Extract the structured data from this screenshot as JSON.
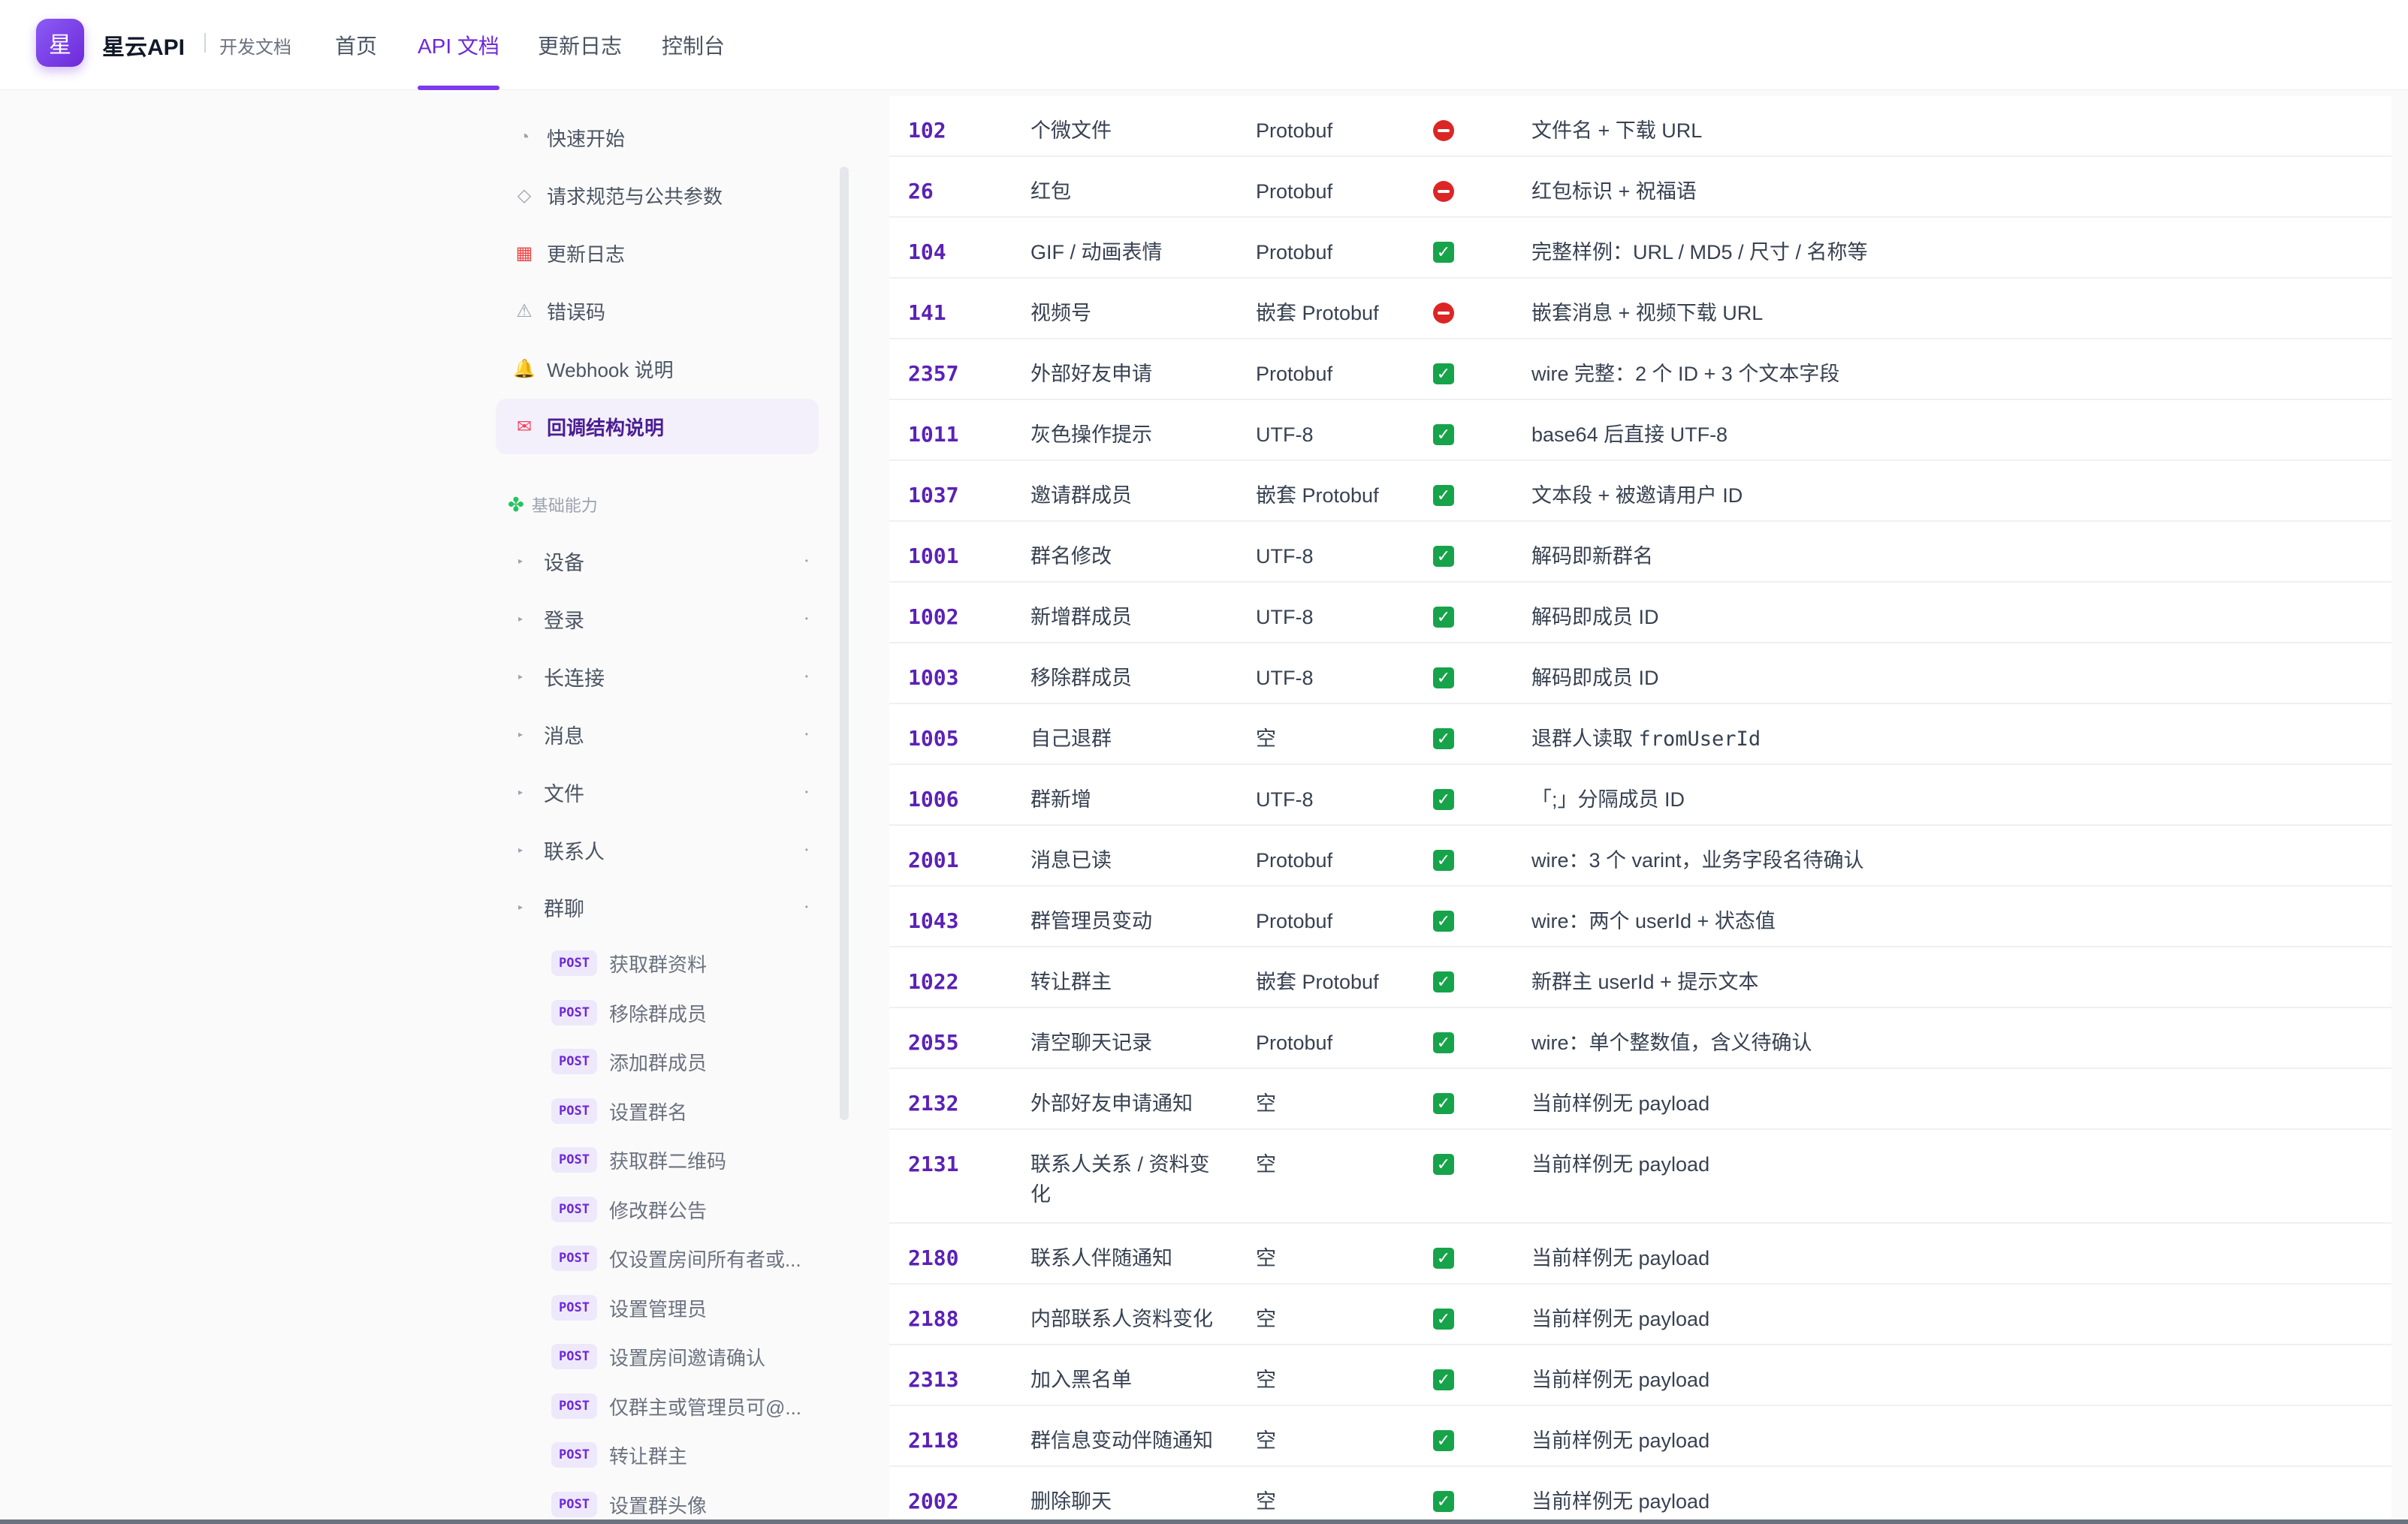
{
  "header": {
    "logo_char": "星",
    "brand": "星云API",
    "subtitle": "开发文档",
    "nav": [
      "首页",
      "API 文档",
      "更新日志",
      "控制台"
    ],
    "active_nav": "API 文档"
  },
  "sidebar": {
    "items": [
      {
        "icon": "◔",
        "icon_name": "clock-icon",
        "label": "快速开始"
      },
      {
        "icon": "◇",
        "icon_name": "diamond-icon",
        "label": "请求规范与公共参数"
      },
      {
        "icon": "▦",
        "icon_name": "calendar-icon",
        "label": "更新日志"
      },
      {
        "icon": "⚠",
        "icon_name": "warning-icon",
        "label": "错误码"
      },
      {
        "icon": "🔔",
        "icon_name": "bell-icon",
        "label": "Webhook 说明"
      },
      {
        "icon": "✉",
        "icon_name": "envelope-icon",
        "label": "回调结构说明"
      }
    ],
    "active_item": "回调结构说明",
    "group_title": "基础能力",
    "categories": [
      "设备",
      "登录",
      "长连接",
      "消息",
      "文件",
      "联系人",
      "群聊"
    ],
    "api_method": "POST",
    "group_chat_apis": [
      "获取群资料",
      "移除群成员",
      "添加群成员",
      "设置群名",
      "获取群二维码",
      "修改群公告",
      "仅设置房间所有者或...",
      "设置管理员",
      "设置房间邀请确认",
      "仅群主或管理员可@...",
      "转让群主",
      "设置群头像"
    ]
  },
  "table": {
    "rows": [
      {
        "code": "102",
        "name": "个微文件",
        "format": "Protobuf",
        "ok": false,
        "desc": "文件名 + 下载 URL"
      },
      {
        "code": "26",
        "name": "红包",
        "format": "Protobuf",
        "ok": false,
        "desc": "红包标识 + 祝福语"
      },
      {
        "code": "104",
        "name": "GIF / 动画表情",
        "format": "Protobuf",
        "ok": true,
        "desc": "完整样例：URL / MD5 / 尺寸 / 名称等"
      },
      {
        "code": "141",
        "name": "视频号",
        "format": "嵌套 Protobuf",
        "ok": false,
        "desc": "嵌套消息 + 视频下载 URL"
      },
      {
        "code": "2357",
        "name": "外部好友申请",
        "format": "Protobuf",
        "ok": true,
        "desc": "wire 完整：2 个 ID + 3 个文本字段"
      },
      {
        "code": "1011",
        "name": "灰色操作提示",
        "format": "UTF-8",
        "ok": true,
        "desc": "base64 后直接 UTF-8"
      },
      {
        "code": "1037",
        "name": "邀请群成员",
        "format": "嵌套 Protobuf",
        "ok": true,
        "desc": "文本段 + 被邀请用户 ID"
      },
      {
        "code": "1001",
        "name": "群名修改",
        "format": "UTF-8",
        "ok": true,
        "desc": "解码即新群名"
      },
      {
        "code": "1002",
        "name": "新增群成员",
        "format": "UTF-8",
        "ok": true,
        "desc": "解码即成员 ID"
      },
      {
        "code": "1003",
        "name": "移除群成员",
        "format": "UTF-8",
        "ok": true,
        "desc": "解码即成员 ID"
      },
      {
        "code": "1005",
        "name": "自己退群",
        "format": "空",
        "ok": true,
        "desc": "退群人读取 ",
        "desc_code": "fromUserId"
      },
      {
        "code": "1006",
        "name": "群新增",
        "format": "UTF-8",
        "ok": true,
        "desc": "「;」分隔成员 ID"
      },
      {
        "code": "2001",
        "name": "消息已读",
        "format": "Protobuf",
        "ok": true,
        "desc": "wire：3 个 varint，业务字段名待确认"
      },
      {
        "code": "1043",
        "name": "群管理员变动",
        "format": "Protobuf",
        "ok": true,
        "desc": "wire：两个 userId + 状态值"
      },
      {
        "code": "1022",
        "name": "转让群主",
        "format": "嵌套 Protobuf",
        "ok": true,
        "desc": "新群主 userId + 提示文本"
      },
      {
        "code": "2055",
        "name": "清空聊天记录",
        "format": "Protobuf",
        "ok": true,
        "desc": "wire：单个整数值，含义待确认"
      },
      {
        "code": "2132",
        "name": "外部好友申请通知",
        "format": "空",
        "ok": true,
        "desc": "当前样例无 payload"
      },
      {
        "code": "2131",
        "name": "联系人关系 / 资料变化",
        "format": "空",
        "ok": true,
        "desc": "当前样例无 payload",
        "tall": true
      },
      {
        "code": "2180",
        "name": "联系人伴随通知",
        "format": "空",
        "ok": true,
        "desc": "当前样例无 payload"
      },
      {
        "code": "2188",
        "name": "内部联系人资料变化",
        "format": "空",
        "ok": true,
        "desc": "当前样例无 payload"
      },
      {
        "code": "2313",
        "name": "加入黑名单",
        "format": "空",
        "ok": true,
        "desc": "当前样例无 payload"
      },
      {
        "code": "2118",
        "name": "群信息变动伴随通知",
        "format": "空",
        "ok": true,
        "desc": "当前样例无 payload"
      },
      {
        "code": "2002",
        "name": "删除聊天",
        "format": "空",
        "ok": true,
        "desc": "当前样例无 payload"
      }
    ]
  },
  "colors": {
    "accent": "#7c3aed",
    "ok": "#16a34a",
    "no": "#dc2626"
  }
}
